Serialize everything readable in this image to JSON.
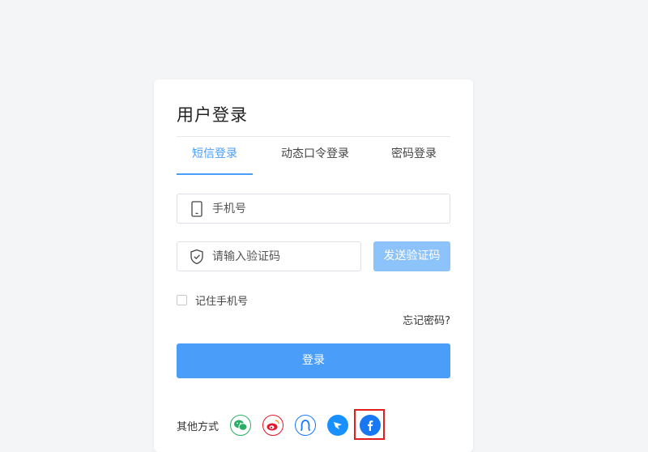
{
  "login": {
    "title": "用户登录",
    "tabs": [
      {
        "label": "短信登录",
        "active": true
      },
      {
        "label": "动态口令登录",
        "active": false
      },
      {
        "label": "密码登录",
        "active": false
      }
    ],
    "phone_placeholder": "手机号",
    "code_placeholder": "请输入验证码",
    "send_code_label": "发送验证码",
    "remember_label": "记住手机号",
    "forgot_label": "忘记密码?",
    "submit_label": "登录",
    "other_label": "其他方式",
    "social": [
      {
        "icon": "wechat-icon",
        "color": "#2aae67"
      },
      {
        "icon": "weibo-icon",
        "color": "#e6162d"
      },
      {
        "icon": "alipay-icon",
        "color": "#1677ff"
      },
      {
        "icon": "dingtalk-icon",
        "color": "#1890ff"
      },
      {
        "icon": "facebook-icon",
        "color": "#1877f2",
        "highlighted": true
      }
    ]
  },
  "colors": {
    "accent": "#4a9df8",
    "accent_light": "#8cc3fa",
    "background": "#f4f5f7",
    "highlight": "#e02020"
  }
}
